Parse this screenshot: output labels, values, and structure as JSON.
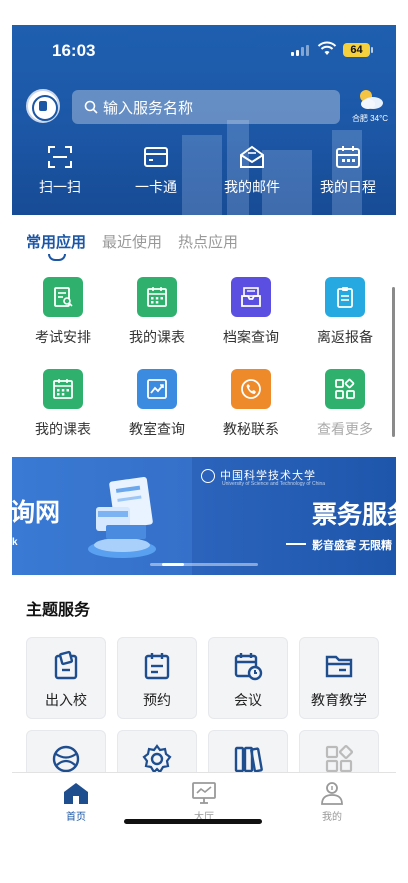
{
  "status_bar": {
    "time": "16:03",
    "battery": "64"
  },
  "header": {
    "search_placeholder": "输入服务名称",
    "weather": {
      "city": "合肥",
      "temp": "34°C"
    },
    "quick_actions": [
      {
        "label": "扫一扫",
        "icon": "scan-icon"
      },
      {
        "label": "一卡通",
        "icon": "card-icon"
      },
      {
        "label": "我的邮件",
        "icon": "mail-icon"
      },
      {
        "label": "我的日程",
        "icon": "calendar-icon"
      }
    ]
  },
  "tabs": [
    {
      "label": "常用应用",
      "active": true
    },
    {
      "label": "最近使用",
      "active": false
    },
    {
      "label": "热点应用",
      "active": false
    }
  ],
  "apps": [
    {
      "label": "考试安排",
      "icon": "exam-icon",
      "color": "#2fb16d"
    },
    {
      "label": "我的课表",
      "icon": "timetable-icon",
      "color": "#2fb16d"
    },
    {
      "label": "档案查询",
      "icon": "archive-icon",
      "color": "#5a4fe0"
    },
    {
      "label": "离返报备",
      "icon": "clipboard-icon",
      "color": "#25a9e0"
    },
    {
      "label": "我的课表",
      "icon": "timetable-icon",
      "color": "#2fb16d"
    },
    {
      "label": "教室查询",
      "icon": "chart-trend-icon",
      "color": "#3b8be0"
    },
    {
      "label": "教秘联系",
      "icon": "phone-icon",
      "color": "#ef8a2a"
    },
    {
      "label": "查看更多",
      "icon": "more-apps-icon",
      "color": "#2fb16d"
    }
  ],
  "banner": {
    "left_title": "询网",
    "left_sub": "k",
    "university": "中国科学技术大学",
    "university_en": "University of Science and Technology of China",
    "right_title": "票务服务",
    "right_sub": "影音盛宴 无限精"
  },
  "theme_section": {
    "title": "主题服务",
    "items": [
      {
        "label": "出入校",
        "icon": "campus-access-icon"
      },
      {
        "label": "预约",
        "icon": "reservation-icon"
      },
      {
        "label": "会议",
        "icon": "meeting-icon"
      },
      {
        "label": "教育教学",
        "icon": "folder-icon"
      },
      {
        "label": "",
        "icon": "globe-icon"
      },
      {
        "label": "",
        "icon": "settings-icon"
      },
      {
        "label": "",
        "icon": "books-icon"
      },
      {
        "label": "",
        "icon": "grid-more-icon"
      }
    ]
  },
  "tab_bar": [
    {
      "label": "首页",
      "icon": "home-icon",
      "active": true
    },
    {
      "label": "大厅",
      "icon": "hall-icon",
      "active": false
    },
    {
      "label": "我的",
      "icon": "profile-icon",
      "active": false
    }
  ]
}
